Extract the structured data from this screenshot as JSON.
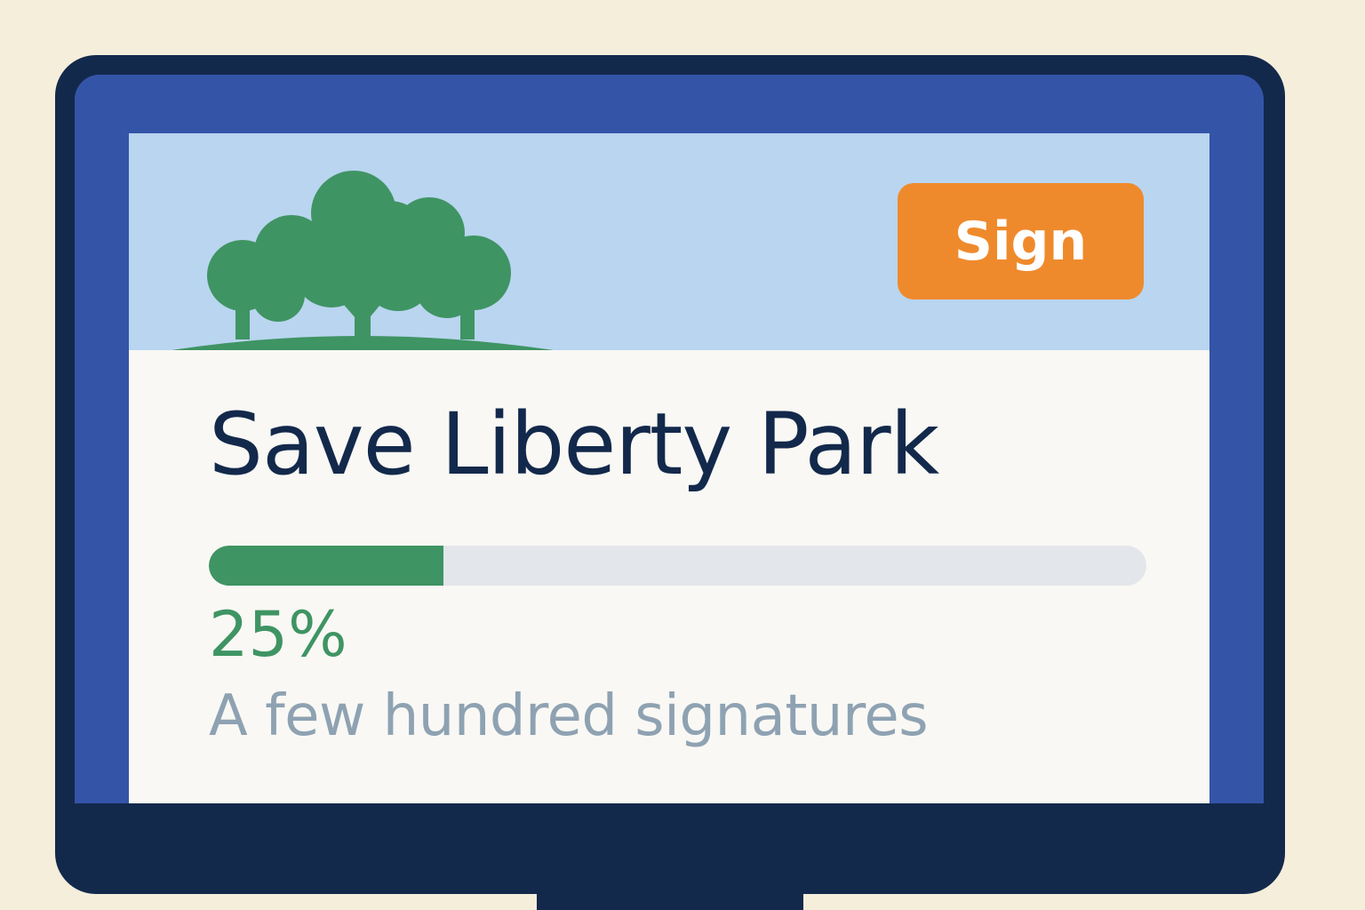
{
  "petition": {
    "title": "Save Liberty Park",
    "sign_label": "Sign",
    "progress_percent": 25,
    "progress_text": "25%",
    "signatures_text": "A few hundred signatures"
  },
  "hero": {
    "illustration": "park-trees-icon"
  },
  "colors": {
    "background": "#f5eedb",
    "monitor_frame": "#13294b",
    "monitor_bezel": "#3454a8",
    "hero_sky": "#b9d5f0",
    "screen_bg": "#f9f8f4",
    "sign_button": "#ef8a2c",
    "progress_fill": "#3f9463",
    "progress_track": "#e3e6ea",
    "title": "#13294b",
    "subtitle": "#8ea2b2"
  }
}
